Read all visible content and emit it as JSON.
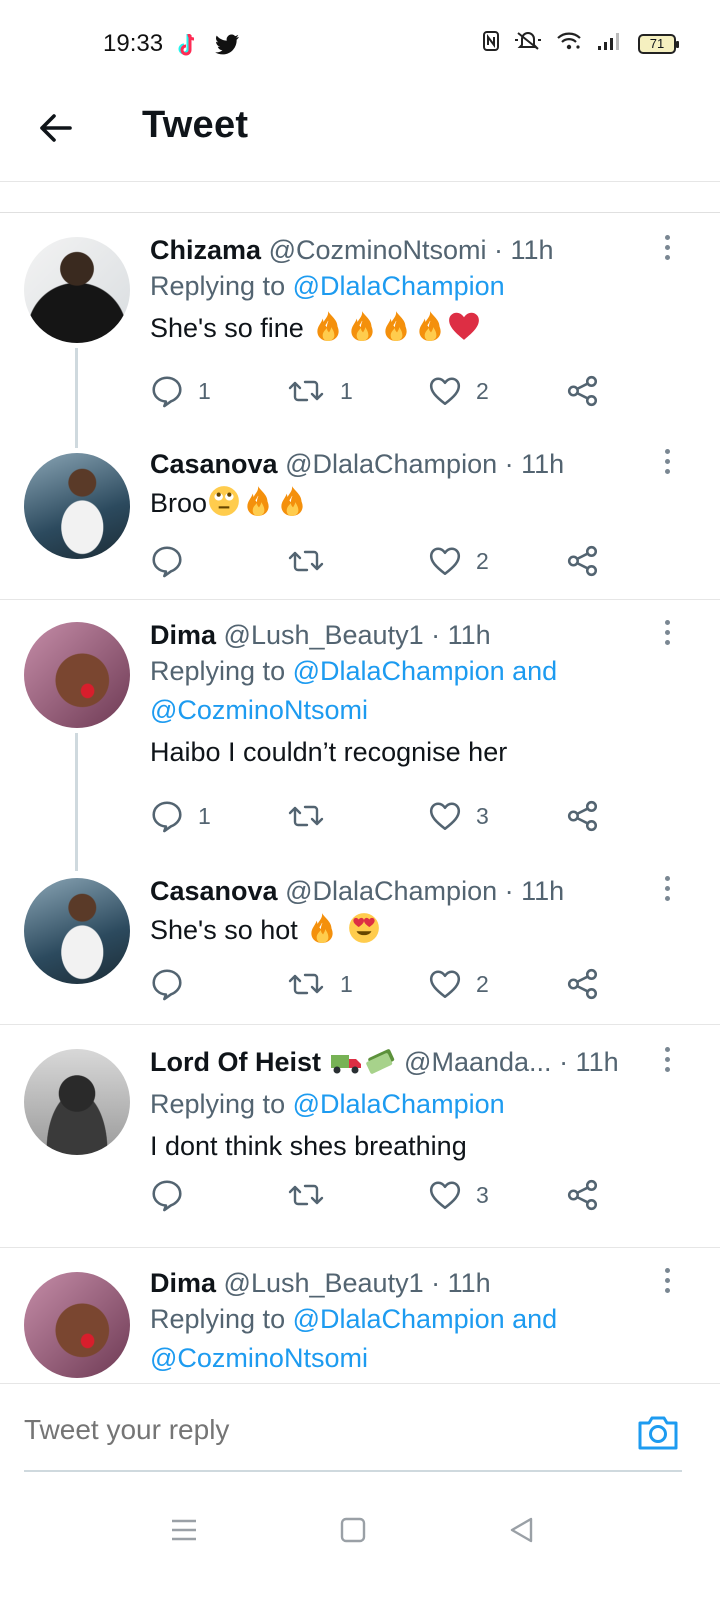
{
  "status_bar": {
    "time": "19:33",
    "battery": "71"
  },
  "header": {
    "title": "Tweet"
  },
  "tweets": [
    {
      "name": "Chizama",
      "handle": "@CozminoNtsomi",
      "time": "· 11h",
      "replying_prefix": "Replying to",
      "replying_to": "@DlalaChampion",
      "text": "She's so fine ",
      "replies": "1",
      "retweets": "1",
      "likes": "2"
    },
    {
      "name": "Casanova",
      "handle": "@DlalaChampion",
      "time": "· 11h",
      "text": "Broo",
      "replies": "",
      "retweets": "",
      "likes": "2"
    },
    {
      "name": "Dima",
      "handle": "@Lush_Beauty1",
      "time": "· 11h",
      "replying_prefix": "Replying to",
      "replying_to": "@DlalaChampion and",
      "replying_to_2": "@CozminoNtsomi",
      "text": "Haibo I couldn’t recognise her",
      "replies": "1",
      "retweets": "",
      "likes": "3"
    },
    {
      "name": "Casanova",
      "handle": "@DlalaChampion",
      "time": "· 11h",
      "text": "She's so hot ",
      "replies": "",
      "retweets": "1",
      "likes": "2"
    },
    {
      "name": "Lord Of Heist",
      "handle": "@Maanda...",
      "time": "· 11h",
      "replying_prefix": "Replying to",
      "replying_to": "@DlalaChampion",
      "text": "I dont think shes breathing",
      "replies": "",
      "retweets": "",
      "likes": "3"
    },
    {
      "name": "Dima",
      "handle": "@Lush_Beauty1",
      "time": "· 11h",
      "replying_prefix": "Replying to",
      "replying_to": "@DlalaChampion and",
      "replying_to_2": "@CozminoNtsomi"
    }
  ],
  "reply_bar": {
    "placeholder": "Tweet your reply"
  },
  "colors": {
    "link": "#1d9bf0",
    "muted": "#536471",
    "text": "#0f1419",
    "thread_line": "#cfd9de"
  },
  "icons": [
    "tiktok-icon",
    "twitter-icon",
    "nfc-icon",
    "mute-icon",
    "wifi-icon",
    "signal-icon",
    "battery-icon",
    "back-arrow-icon",
    "reply-icon",
    "retweet-icon",
    "like-icon",
    "share-icon",
    "more-icon",
    "camera-icon",
    "menu-icon",
    "home-square-icon",
    "back-triangle-icon",
    "fire-emoji",
    "heart-emoji",
    "rolling-eyes-emoji",
    "heart-eyes-emoji",
    "truck-emoji",
    "money-emoji"
  ]
}
